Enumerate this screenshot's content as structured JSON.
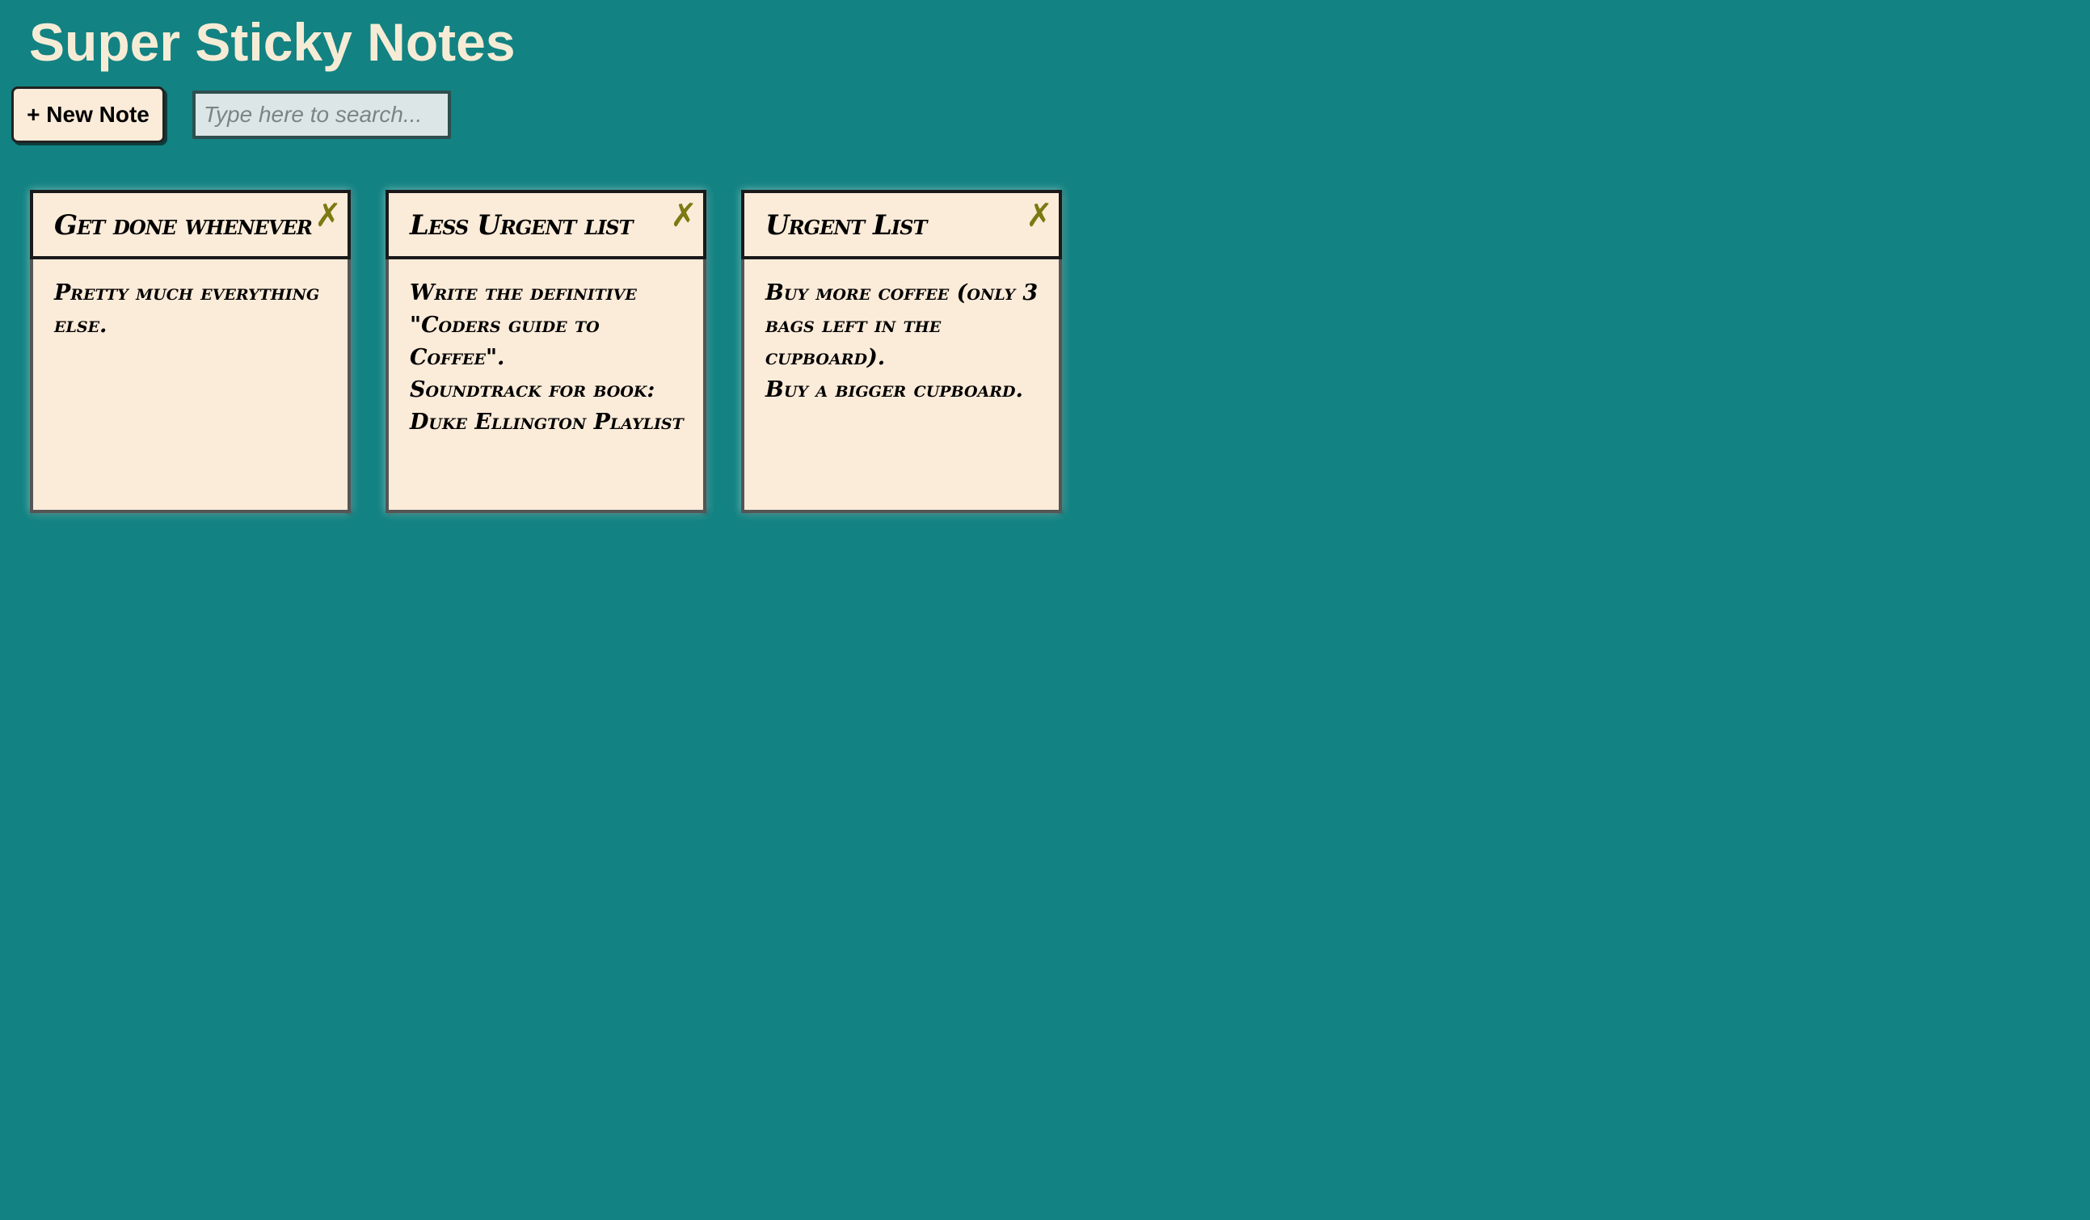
{
  "app": {
    "title": "Super Sticky Notes"
  },
  "toolbar": {
    "new_note_label": "+ New Note",
    "search": {
      "value": "",
      "placeholder": "Type here to search..."
    }
  },
  "notes": [
    {
      "title": "Get done whenever",
      "body": "Pretty much everything else.",
      "close_label": "✗",
      "close_icon": "close-x-icon"
    },
    {
      "title": "Less Urgent list",
      "body": "Write the definitive \"Coders guide to Coffee\".\nSoundtrack for book: Duke Ellington Playlist",
      "close_label": "✗",
      "close_icon": "close-x-icon"
    },
    {
      "title": "Urgent List",
      "body": "Buy more coffee (only 3 bags left in the cupboard).\nBuy a bigger cupboard.",
      "close_label": "✗",
      "close_icon": "close-x-icon"
    }
  ],
  "colors": {
    "background": "#138282",
    "title_text": "#f6ecd6",
    "note_paper": "#fbebd9",
    "close_icon": "#7a7a12",
    "search_bg": "#dde6e6"
  }
}
